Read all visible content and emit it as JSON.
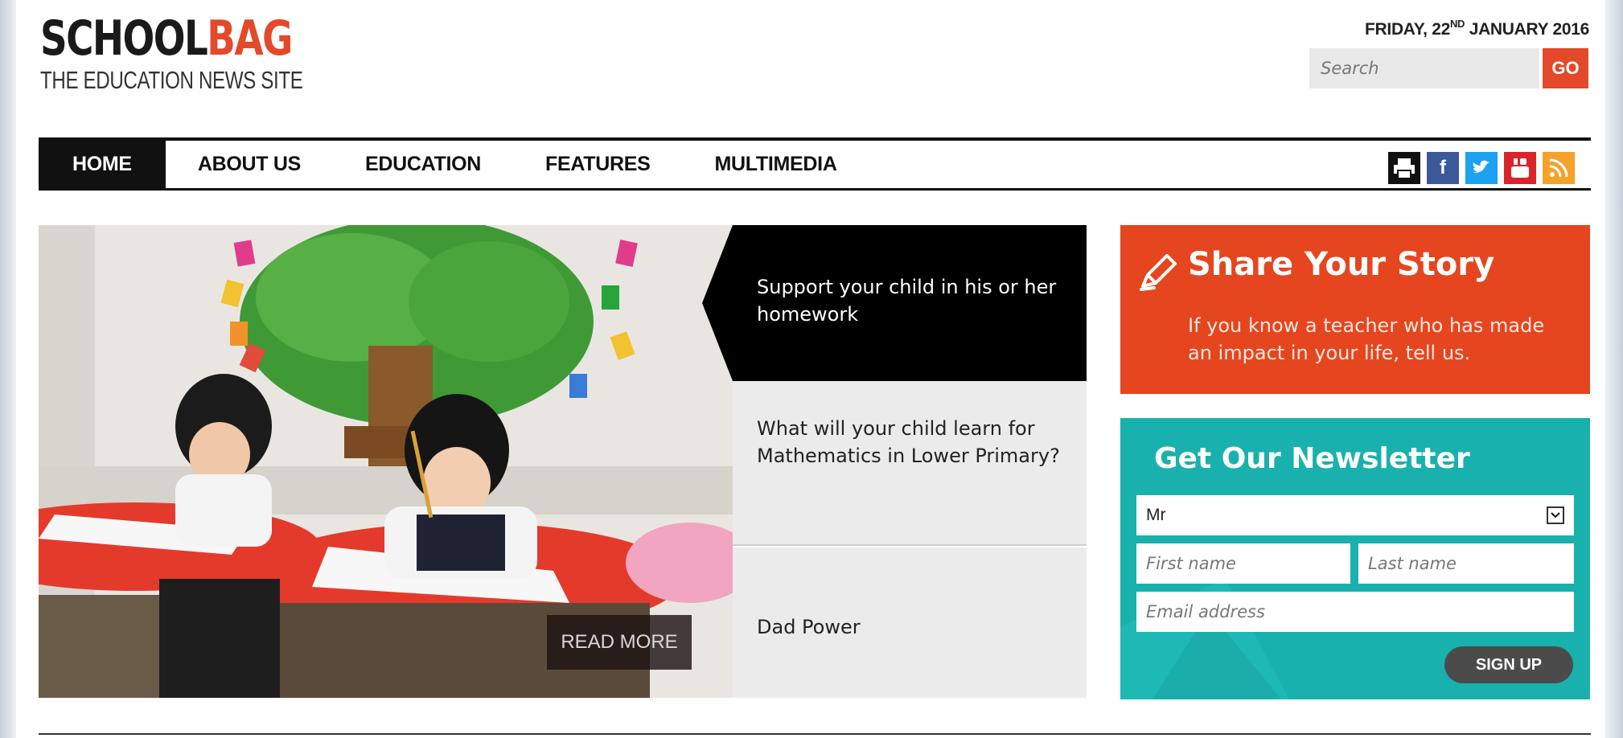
{
  "header": {
    "logo_part1": "SCHOOL",
    "logo_part2": "BAG",
    "tagline": "THE EDUCATION NEWS SITE",
    "date_prefix": "FRIDAY, 22",
    "date_suffix": "ND",
    "date_rest": " JANUARY 2016",
    "search_placeholder": "Search",
    "go_label": "GO"
  },
  "nav": {
    "items": [
      "HOME",
      "ABOUT US",
      "EDUCATION",
      "FEATURES",
      "MULTIMEDIA"
    ],
    "active": "HOME"
  },
  "social": {
    "icons": [
      "print-icon",
      "facebook-icon",
      "twitter-icon",
      "youtube-icon",
      "rss-icon"
    ],
    "facebook_glyph": "f",
    "colors": {
      "print": "#111111",
      "facebook": "#3b5998",
      "twitter": "#1da1f2",
      "youtube": "#d9252a",
      "rss": "#f5a12a"
    }
  },
  "hero": {
    "read_more": "READ MORE"
  },
  "stories": [
    "Support your child in his or her homework",
    "What will your child learn for Mathematics in Lower Primary?",
    "Dad Power"
  ],
  "share": {
    "title": "Share Your Story",
    "text": "If you know a teacher who has made an impact in your life, tell us."
  },
  "newsletter": {
    "title": "Get Our Newsletter",
    "salutation_value": "Mr",
    "first_name_placeholder": "First name",
    "last_name_placeholder": "Last name",
    "email_placeholder": "Email address",
    "signup_label": "SIGN UP"
  },
  "colors": {
    "accent": "#e3492a",
    "teal": "#19b1ad",
    "dark": "#111111"
  }
}
